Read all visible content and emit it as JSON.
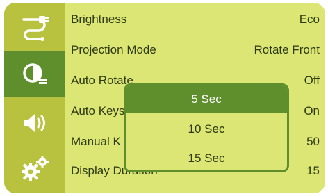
{
  "colors": {
    "screen_bg": "#dce675",
    "sidebar_bg": "#b8c23f",
    "accent": "#5f8f2c",
    "text": "#2f3a12"
  },
  "sidebar": {
    "items": [
      {
        "icon": "cable-icon",
        "active": false
      },
      {
        "icon": "picture-settings-icon",
        "active": true
      },
      {
        "icon": "volume-icon",
        "active": false
      },
      {
        "icon": "gears-icon",
        "active": false
      }
    ]
  },
  "menu": {
    "rows": [
      {
        "label": "Brightness",
        "value": "Eco"
      },
      {
        "label": "Projection Mode",
        "value": "Rotate Front"
      },
      {
        "label": "Auto Rotate",
        "value": "Off"
      },
      {
        "label": "Auto Keys",
        "value": "On"
      },
      {
        "label": "Manual K",
        "value": "50"
      },
      {
        "label": "Display Duration",
        "value": "15"
      }
    ]
  },
  "popup": {
    "options": [
      "5 Sec",
      "10 Sec",
      "15 Sec"
    ],
    "selected": "5 Sec"
  }
}
